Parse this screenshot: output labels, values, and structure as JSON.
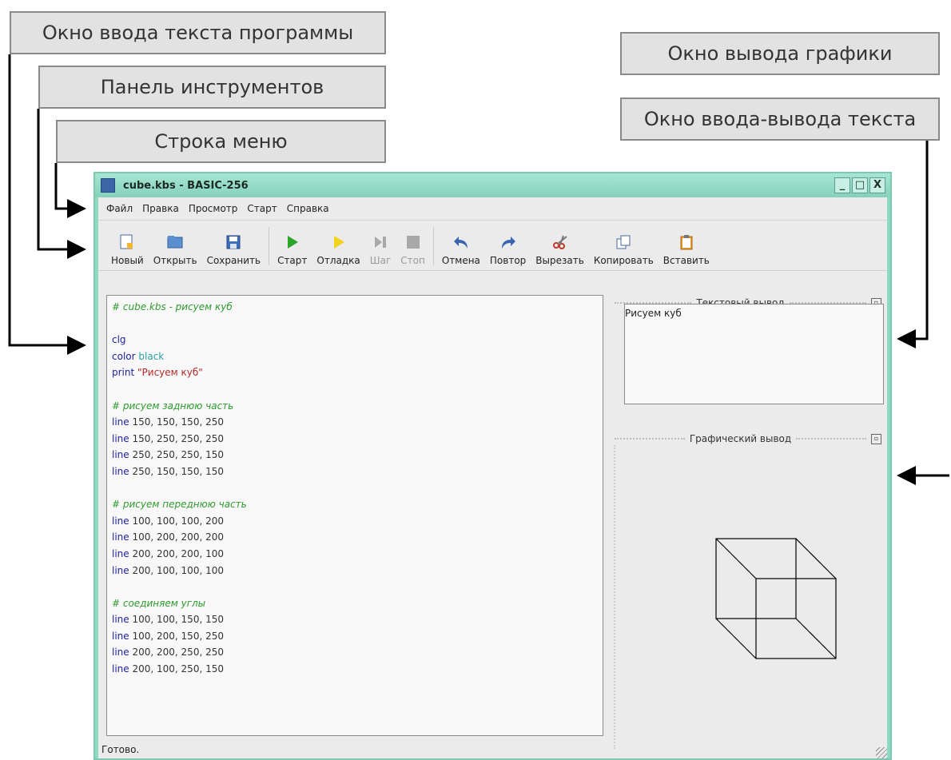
{
  "callouts": {
    "code_window": "Окно ввода текста программы",
    "toolbar": "Панель инструментов",
    "menubar": "Строка меню",
    "graphics_window": "Окно вывода графики",
    "text_io_window": "Окно ввода-вывода текста"
  },
  "window": {
    "title": "cube.kbs - BASIC-256",
    "controls": [
      "_",
      "□",
      "X"
    ]
  },
  "menu": [
    "Файл",
    "Правка",
    "Просмотр",
    "Старт",
    "Справка"
  ],
  "toolbar": {
    "new": "Новый",
    "open": "Открыть",
    "save": "Сохранить",
    "run": "Старт",
    "debug": "Отладка",
    "step": "Шаг",
    "stop": "Стоп",
    "undo": "Отмена",
    "redo": "Повтор",
    "cut": "Вырезать",
    "copy": "Копировать",
    "paste": "Вставить"
  },
  "editor": {
    "lines": [
      "# cube.kbs - рисуем куб",
      "",
      "clg",
      "color black",
      "print \"Рисуем куб\"",
      "",
      "# рисуем заднюю часть",
      "line 150, 150, 150, 250",
      "line 150, 250, 250, 250",
      "line 250, 250, 250, 150",
      "line 250, 150, 150, 150",
      "",
      "# рисуем переднюю часть",
      "line 100, 100, 100, 200",
      "line 100, 200, 200, 200",
      "line 200, 200, 200, 100",
      "line 200, 100, 100, 100",
      "",
      "# соединяем углы",
      "line 100, 100, 150, 150",
      "line 100, 200, 150, 250",
      "line 200, 200, 250, 250",
      "line 200, 100, 250, 150"
    ]
  },
  "text_output": {
    "title": "Текстовый вывод",
    "content": "Рисуем куб"
  },
  "graphics_output": {
    "title": "Графический вывод"
  },
  "status": "Готово."
}
